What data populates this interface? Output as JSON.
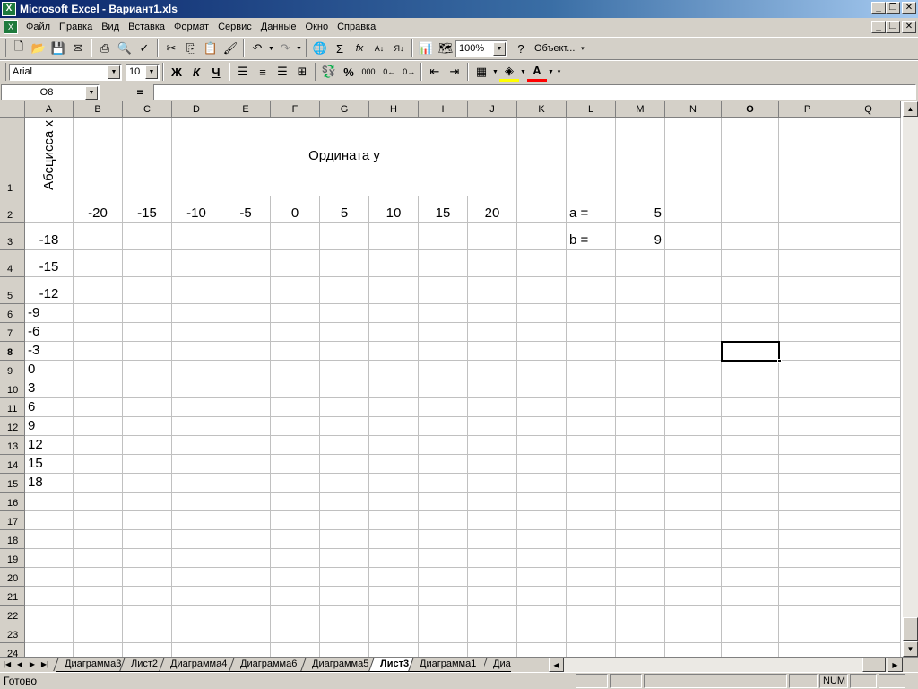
{
  "window": {
    "title": "Microsoft Excel - Вариант1.xls",
    "app_icon": "excel-icon"
  },
  "menu": [
    "Файл",
    "Правка",
    "Вид",
    "Вставка",
    "Формат",
    "Сервис",
    "Данные",
    "Окно",
    "Справка"
  ],
  "toolbar": {
    "zoom": "100%",
    "objects_label": "Объект...",
    "font_name": "Arial",
    "font_size": "10",
    "bold": "Ж",
    "italic": "К",
    "underline": "Ч",
    "percent": "%",
    "thousands": "000",
    "sum": "Σ"
  },
  "formula_bar": {
    "name_box": "O8",
    "equals": "=",
    "formula": ""
  },
  "columns": [
    "A",
    "B",
    "C",
    "D",
    "E",
    "F",
    "G",
    "H",
    "I",
    "J",
    "K",
    "L",
    "M",
    "N",
    "O",
    "P",
    "Q"
  ],
  "rows": [
    "1",
    "2",
    "3",
    "4",
    "5",
    "6",
    "7",
    "8",
    "9",
    "10",
    "11",
    "12",
    "13",
    "14",
    "15",
    "16",
    "17",
    "18",
    "19",
    "20",
    "21",
    "22",
    "23",
    "24"
  ],
  "active_cell": {
    "column": "O",
    "row": "8"
  },
  "cells": {
    "A1": "Абсцисса x",
    "D1": "Ордината у",
    "B2": "-20",
    "C2": "-15",
    "D2": "-10",
    "E2": "-5",
    "F2": "0",
    "G2": "5",
    "H2": "10",
    "I2": "15",
    "J2": "20",
    "L2": "a =",
    "M2": "5",
    "L3": "b =",
    "M3": "9",
    "A3": "-18",
    "A4": "-15",
    "A5": "-12",
    "A6": "-9",
    "A7": "-6",
    "A8": "-3",
    "A9": "0",
    "A10": "3",
    "A11": "6",
    "A12": "9",
    "A13": "12",
    "A14": "15",
    "A15": "18"
  },
  "sheet_tabs": [
    "Диаграмма3",
    "Лист2",
    "Диаграмма4",
    "Диаграмма6",
    "Диаграмма5",
    "Лист3",
    "Диаграмма1",
    "Диа"
  ],
  "active_tab": "Лист3",
  "status": {
    "text": "Готово",
    "num": "NUM"
  }
}
